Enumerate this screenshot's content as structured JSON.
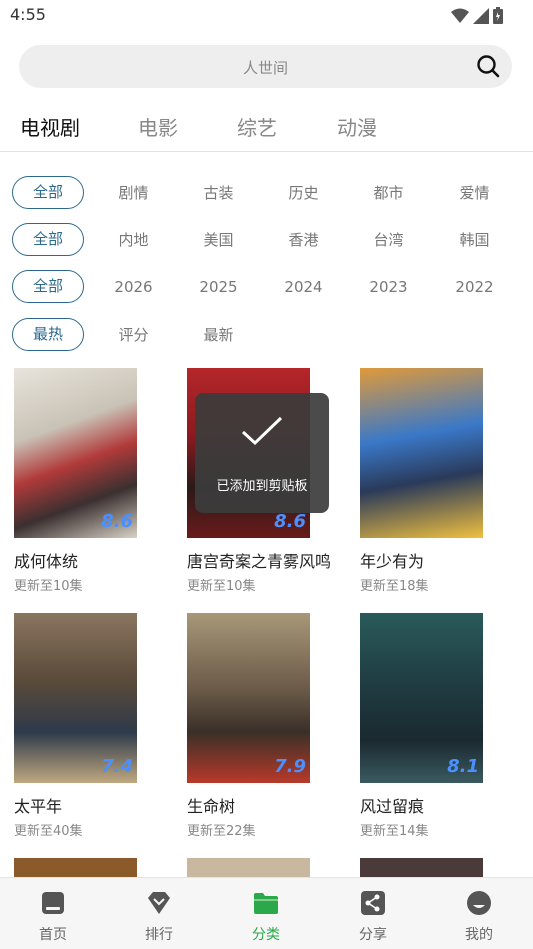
{
  "status": {
    "time": "4:55"
  },
  "search": {
    "placeholder": "人世间"
  },
  "main_tabs": [
    {
      "label": "电视剧",
      "active": true
    },
    {
      "label": "电影",
      "active": false
    },
    {
      "label": "综艺",
      "active": false
    },
    {
      "label": "动漫",
      "active": false
    }
  ],
  "filters": {
    "genre": [
      "全部",
      "剧情",
      "古装",
      "历史",
      "都市",
      "爱情"
    ],
    "region": [
      "全部",
      "内地",
      "美国",
      "香港",
      "台湾",
      "韩国"
    ],
    "year": [
      "全部",
      "2026",
      "2025",
      "2024",
      "2023",
      "2022"
    ],
    "sort": [
      "最热",
      "评分",
      "最新"
    ]
  },
  "cards": [
    {
      "title": "成何体统",
      "subtitle": "更新至10集",
      "score": "8.6"
    },
    {
      "title": "唐宫奇案之青雾风鸣",
      "subtitle": "更新至10集",
      "score": "8.6"
    },
    {
      "title": "年少有为",
      "subtitle": "更新至18集",
      "score": ""
    },
    {
      "title": "太平年",
      "subtitle": "更新至40集",
      "score": "7.4"
    },
    {
      "title": "生命树",
      "subtitle": "更新至22集",
      "score": "7.9"
    },
    {
      "title": "风过留痕",
      "subtitle": "更新至14集",
      "score": "8.1"
    }
  ],
  "toast": {
    "text": "已添加到剪贴板"
  },
  "bottom_nav": [
    {
      "label": "首页",
      "icon": "home-icon"
    },
    {
      "label": "排行",
      "icon": "rank-icon"
    },
    {
      "label": "分类",
      "icon": "folder-icon",
      "active": true
    },
    {
      "label": "分享",
      "icon": "share-icon"
    },
    {
      "label": "我的",
      "icon": "profile-icon"
    }
  ],
  "colors": {
    "accent": "#2b6a8e",
    "nav_active": "#2aa84a"
  }
}
